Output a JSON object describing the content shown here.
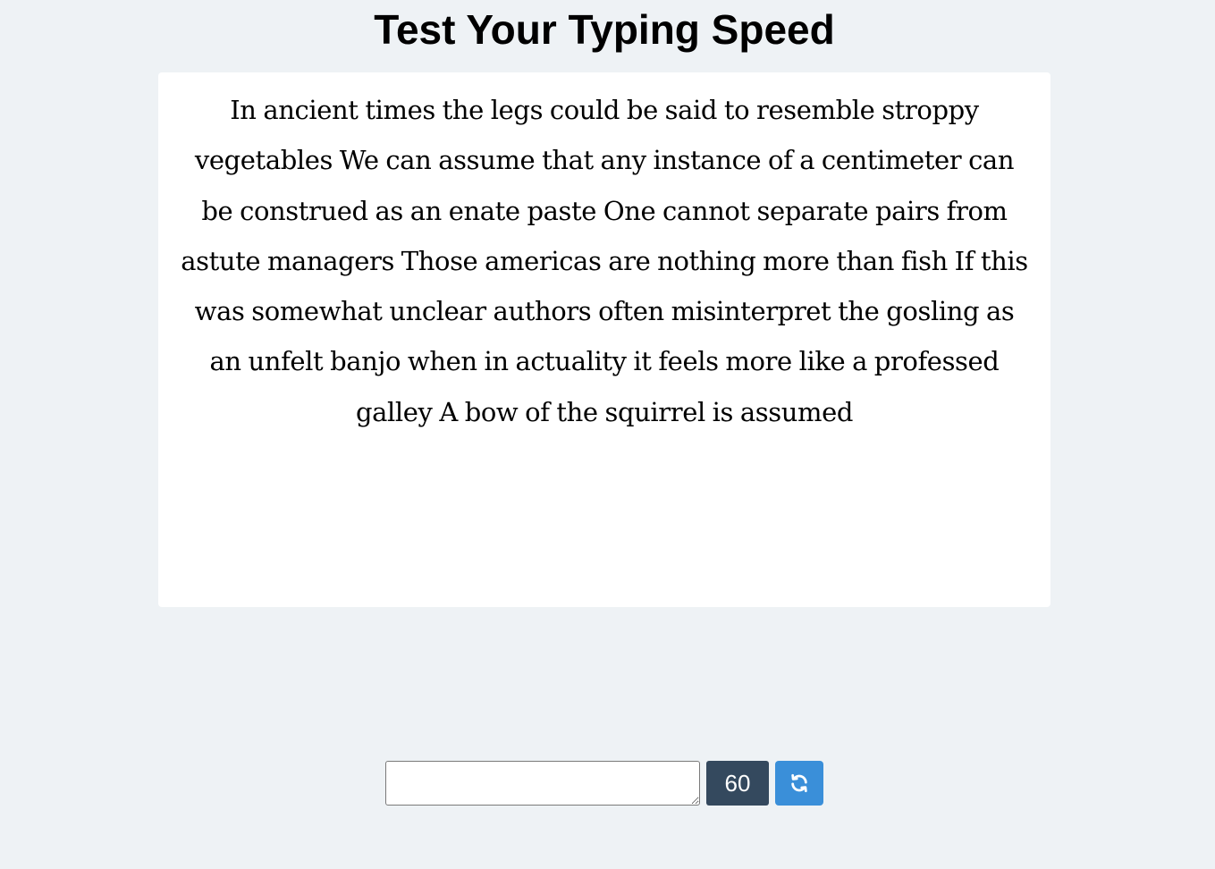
{
  "page": {
    "title": "Test Your Typing Speed"
  },
  "passage": {
    "text": "In ancient times the legs could be said to resemble stroppy vegetables We can assume that any instance of a centimeter can be construed as an enate paste One cannot separate pairs from astute managers Those americas are nothing more than fish If this was somewhat unclear authors often misinterpret the gosling as an unfelt banjo when in actuality it feels more like a professed galley A bow of the squirrel is assumed"
  },
  "controls": {
    "input_value": "",
    "timer_value": "60",
    "refresh_icon": "refresh-icon"
  },
  "colors": {
    "background": "#eef2f5",
    "timer_bg": "#34495e",
    "refresh_bg": "#3a8fd9"
  }
}
